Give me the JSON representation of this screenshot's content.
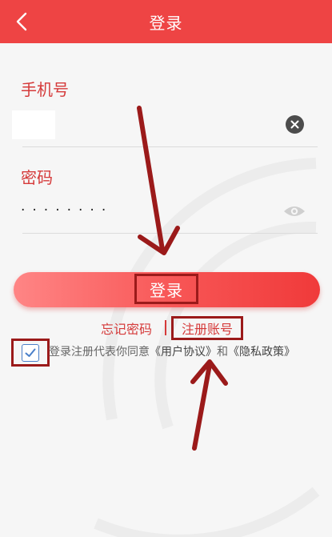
{
  "header": {
    "title": "登录",
    "background": "#ee4444"
  },
  "form": {
    "phone_label": "手机号",
    "phone_value": "",
    "password_label": "密码",
    "password_masked": "········"
  },
  "actions": {
    "login_label": "登录",
    "forgot_label": "忘记密码",
    "register_label": "注册账号"
  },
  "agreement": {
    "checked": true,
    "prefix": "登录注册代表你同意",
    "user_agreement": "《用户协议》",
    "conjunction": "和",
    "privacy_policy": "《隐私政策》"
  },
  "icons": {
    "back": "chevron-left-icon",
    "clear": "clear-icon",
    "visibility": "eye-icon",
    "check": "check-icon",
    "annotation": "arrow-icon"
  },
  "colors": {
    "accent": "#ee4444",
    "label": "#d53a3a",
    "annotation": "#9b1a1a",
    "checkbox": "#4a7fc9"
  }
}
